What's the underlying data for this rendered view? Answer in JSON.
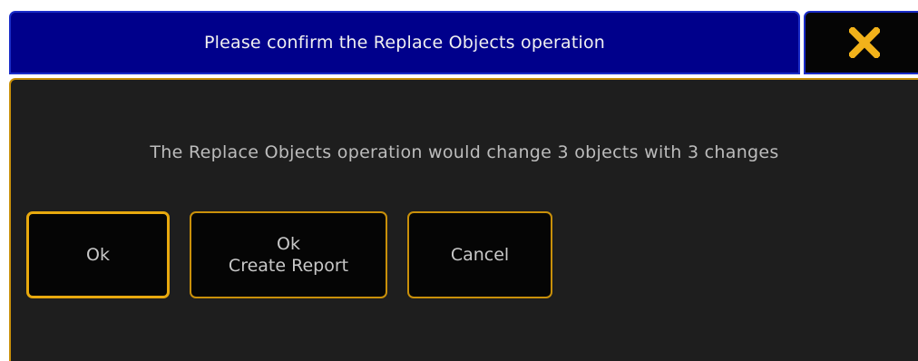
{
  "dialog": {
    "title": "Please confirm the Replace Objects operation",
    "close_icon": "close-x-icon",
    "message": "The Replace Objects operation would change 3 objects with 3 changes",
    "buttons": {
      "ok": "Ok",
      "ok_report_line1": "Ok",
      "ok_report_line2": "Create Report",
      "cancel": "Cancel"
    }
  },
  "colors": {
    "title_background": "#00008b",
    "accent_border": "#c9900a",
    "close_icon": "#f2b21a",
    "body_background": "#1e1e1e"
  }
}
